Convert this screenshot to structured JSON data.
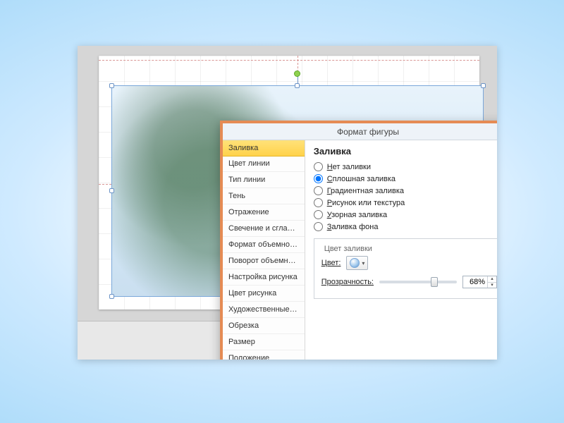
{
  "dialog": {
    "title": "Формат фигуры",
    "nav": [
      "Заливка",
      "Цвет линии",
      "Тип линии",
      "Тень",
      "Отражение",
      "Свечение и сглаживание",
      "Формат объемной фигуры",
      "Поворот объемной фигуры",
      "Настройка рисунка",
      "Цвет рисунка",
      "Художественные эффекты",
      "Обрезка",
      "Размер",
      "Положение"
    ],
    "selected_nav_index": 0,
    "panel": {
      "heading": "Заливка",
      "radios": [
        {
          "prefix": "Н",
          "rest": "ет заливки",
          "checked": false
        },
        {
          "prefix": "С",
          "rest": "плошная заливка",
          "checked": true
        },
        {
          "prefix": "Г",
          "rest": "радиентная заливка",
          "checked": false
        },
        {
          "prefix": "Р",
          "rest": "исунок или текстура",
          "checked": false
        },
        {
          "prefix": "У",
          "rest": "зорная заливка",
          "checked": false
        },
        {
          "prefix": "З",
          "rest": "аливка фона",
          "checked": false
        }
      ],
      "fill_group_legend": "Цвет заливки",
      "color_label": "Цвет:",
      "transparency_label": "Прозрачность:",
      "transparency_value": "68%"
    }
  }
}
